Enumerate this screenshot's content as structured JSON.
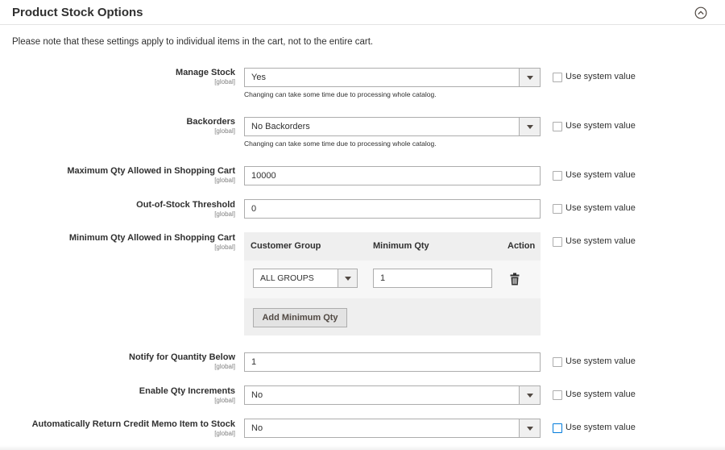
{
  "section": {
    "title": "Product Stock Options",
    "note": "Please note that these settings apply to individual items in the cart, not to the entire cart."
  },
  "use_system_label": "Use system value",
  "catalog_hint": "Changing can take some time due to processing whole catalog.",
  "fields": {
    "manage_stock": {
      "label": "Manage Stock",
      "scope": "[global]",
      "value": "Yes"
    },
    "backorders": {
      "label": "Backorders",
      "scope": "[global]",
      "value": "No Backorders"
    },
    "max_qty": {
      "label": "Maximum Qty Allowed in Shopping Cart",
      "scope": "[global]",
      "value": "10000"
    },
    "out_of_stock": {
      "label": "Out-of-Stock Threshold",
      "scope": "[global]",
      "value": "0"
    },
    "min_qty": {
      "label": "Minimum Qty Allowed in Shopping Cart",
      "scope": "[global]",
      "columns": [
        "Customer Group",
        "Minimum Qty",
        "Action"
      ],
      "rows": [
        {
          "group": "ALL GROUPS",
          "qty": "1"
        }
      ],
      "add_button": "Add Minimum Qty"
    },
    "notify_below": {
      "label": "Notify for Quantity Below",
      "scope": "[global]",
      "value": "1"
    },
    "qty_increments": {
      "label": "Enable Qty Increments",
      "scope": "[global]",
      "value": "No"
    },
    "credit_memo": {
      "label": "Automatically Return Credit Memo Item to Stock",
      "scope": "[global]",
      "value": "No"
    }
  },
  "icons": {
    "collapse": "chevron-up-circle-icon",
    "delete": "trash-icon",
    "dropdown": "chevron-down-icon"
  },
  "colors": {
    "text": "#303030",
    "border": "#adadad",
    "grid_bg": "#efefef",
    "focus": "#007bdb"
  }
}
